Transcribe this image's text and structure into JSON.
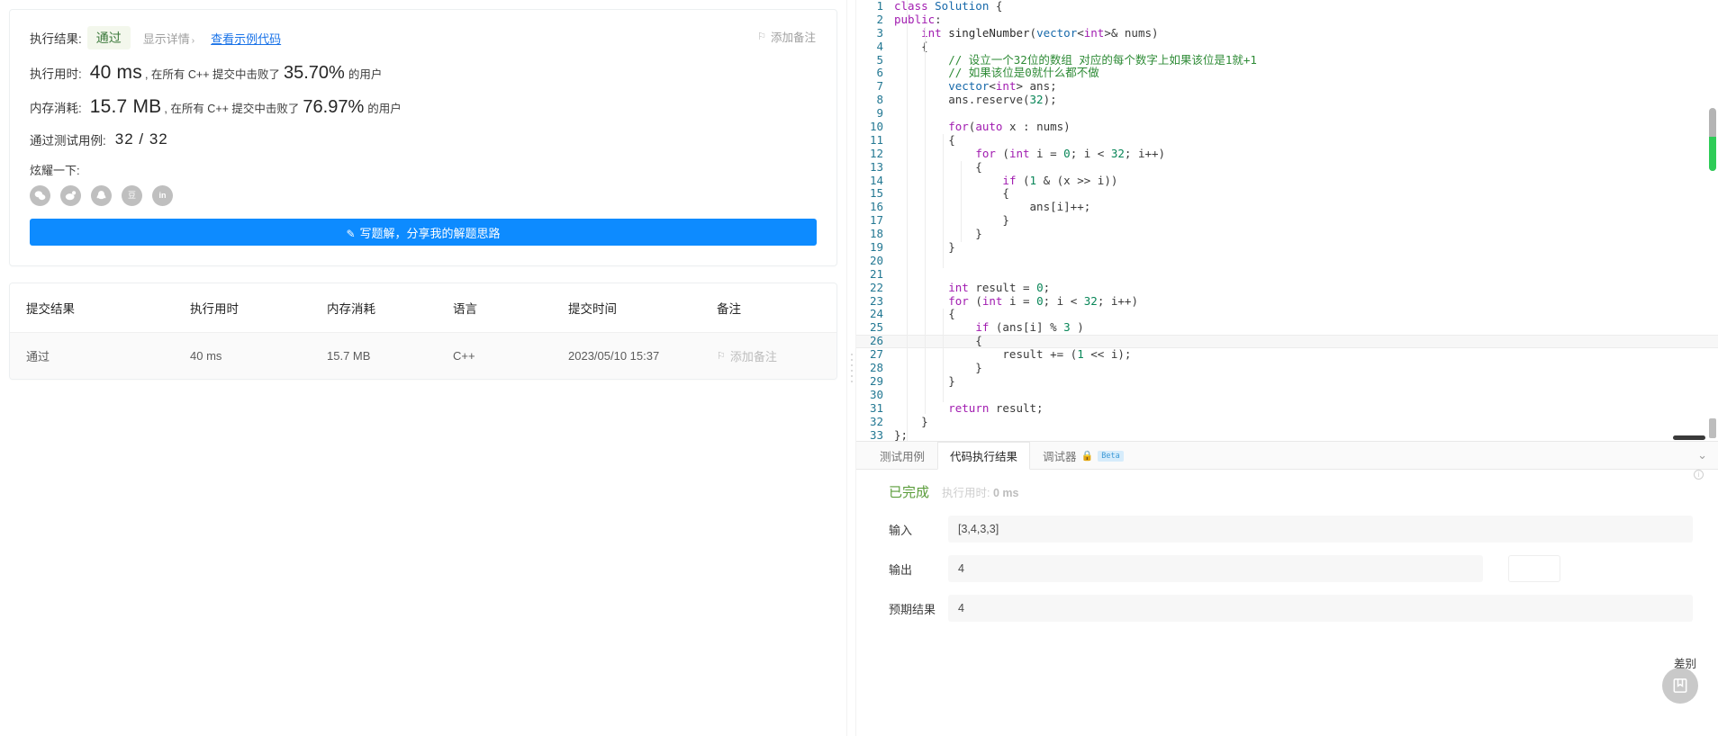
{
  "left": {
    "result_card": {
      "result_label": "执行结果:",
      "result_value": "通过",
      "show_detail": "显示详情",
      "show_detail_chevron": "›",
      "sample_code_link": "查看示例代码",
      "runtime_label": "执行用时:",
      "runtime_value": "40 ms",
      "runtime_mid": ", 在所有 C++ 提交中击败了",
      "runtime_pct": "35.70%",
      "runtime_tail": "的用户",
      "memory_label": "内存消耗:",
      "memory_value": "15.7 MB",
      "memory_mid": ", 在所有 C++ 提交中击败了",
      "memory_pct": "76.97%",
      "memory_tail": "的用户",
      "cases_label": "通过测试用例:",
      "cases_value": "32 / 32",
      "share_label": "炫耀一下:",
      "share_icons": [
        {
          "name": "wechat-share-icon",
          "glyph": "微"
        },
        {
          "name": "weibo-share-icon",
          "glyph": "微"
        },
        {
          "name": "qq-share-icon",
          "glyph": "Q"
        },
        {
          "name": "douban-share-icon",
          "glyph": "豆"
        },
        {
          "name": "linkedin-share-icon",
          "glyph": "in"
        }
      ],
      "write_solution_button": "写题解，分享我的解题思路",
      "add_note_top": "添加备注"
    },
    "submissions_table": {
      "headers": [
        "提交结果",
        "执行用时",
        "内存消耗",
        "语言",
        "提交时间",
        "备注"
      ],
      "rows": [
        {
          "result": "通过",
          "runtime": "40 ms",
          "memory": "15.7 MB",
          "language": "C++",
          "time": "2023/05/10 15:37",
          "note": "添加备注"
        }
      ]
    }
  },
  "editor": {
    "language": "cpp",
    "active_line": 26,
    "lines": [
      {
        "n": 1,
        "tokens": [
          {
            "t": "class ",
            "c": "kw"
          },
          {
            "t": "Solution ",
            "c": "typ"
          },
          {
            "t": "{",
            "c": "pun"
          }
        ]
      },
      {
        "n": 2,
        "tokens": [
          {
            "t": "public",
            "c": "kw"
          },
          {
            "t": ":",
            "c": "pun"
          }
        ]
      },
      {
        "n": 3,
        "tokens": [
          {
            "t": "    ",
            "c": "pun"
          },
          {
            "t": "int ",
            "c": "kw"
          },
          {
            "t": "singleNumber",
            "c": "fn"
          },
          {
            "t": "(",
            "c": "pun"
          },
          {
            "t": "vector",
            "c": "typ"
          },
          {
            "t": "<",
            "c": "pun"
          },
          {
            "t": "int",
            "c": "kw"
          },
          {
            "t": ">& nums)",
            "c": "pun"
          }
        ]
      },
      {
        "n": 4,
        "tokens": [
          {
            "t": "    {",
            "c": "pun"
          }
        ]
      },
      {
        "n": 5,
        "tokens": [
          {
            "t": "        // 设立一个32位的数组 对应的每个数字上如果该位是1就+1",
            "c": "cmt"
          }
        ]
      },
      {
        "n": 6,
        "tokens": [
          {
            "t": "        // 如果该位是0就什么都不做",
            "c": "cmt"
          }
        ]
      },
      {
        "n": 7,
        "tokens": [
          {
            "t": "        ",
            "c": "pun"
          },
          {
            "t": "vector",
            "c": "typ"
          },
          {
            "t": "<",
            "c": "pun"
          },
          {
            "t": "int",
            "c": "kw"
          },
          {
            "t": "> ans;",
            "c": "pun"
          }
        ]
      },
      {
        "n": 8,
        "tokens": [
          {
            "t": "        ans.reserve(",
            "c": "pun"
          },
          {
            "t": "32",
            "c": "num"
          },
          {
            "t": ");",
            "c": "pun"
          }
        ]
      },
      {
        "n": 9,
        "tokens": []
      },
      {
        "n": 10,
        "tokens": [
          {
            "t": "        ",
            "c": "pun"
          },
          {
            "t": "for",
            "c": "kw"
          },
          {
            "t": "(",
            "c": "pun"
          },
          {
            "t": "auto",
            "c": "kw"
          },
          {
            "t": " x : nums)",
            "c": "pun"
          }
        ]
      },
      {
        "n": 11,
        "tokens": [
          {
            "t": "        {",
            "c": "pun"
          }
        ]
      },
      {
        "n": 12,
        "tokens": [
          {
            "t": "            ",
            "c": "pun"
          },
          {
            "t": "for",
            "c": "kw"
          },
          {
            "t": " (",
            "c": "pun"
          },
          {
            "t": "int",
            "c": "kw"
          },
          {
            "t": " i = ",
            "c": "pun"
          },
          {
            "t": "0",
            "c": "num"
          },
          {
            "t": "; i < ",
            "c": "pun"
          },
          {
            "t": "32",
            "c": "num"
          },
          {
            "t": "; i++)",
            "c": "pun"
          }
        ]
      },
      {
        "n": 13,
        "tokens": [
          {
            "t": "            {",
            "c": "pun"
          }
        ]
      },
      {
        "n": 14,
        "tokens": [
          {
            "t": "                ",
            "c": "pun"
          },
          {
            "t": "if",
            "c": "kw"
          },
          {
            "t": " (",
            "c": "pun"
          },
          {
            "t": "1",
            "c": "num"
          },
          {
            "t": " & (x >> i))",
            "c": "pun"
          }
        ]
      },
      {
        "n": 15,
        "tokens": [
          {
            "t": "                {",
            "c": "pun"
          }
        ]
      },
      {
        "n": 16,
        "tokens": [
          {
            "t": "                    ans[i]++;",
            "c": "pun"
          }
        ]
      },
      {
        "n": 17,
        "tokens": [
          {
            "t": "                }",
            "c": "pun"
          }
        ]
      },
      {
        "n": 18,
        "tokens": [
          {
            "t": "            }",
            "c": "pun"
          }
        ]
      },
      {
        "n": 19,
        "tokens": [
          {
            "t": "        }",
            "c": "pun"
          }
        ]
      },
      {
        "n": 20,
        "tokens": []
      },
      {
        "n": 21,
        "tokens": []
      },
      {
        "n": 22,
        "tokens": [
          {
            "t": "        ",
            "c": "pun"
          },
          {
            "t": "int",
            "c": "kw"
          },
          {
            "t": " result = ",
            "c": "pun"
          },
          {
            "t": "0",
            "c": "num"
          },
          {
            "t": ";",
            "c": "pun"
          }
        ]
      },
      {
        "n": 23,
        "tokens": [
          {
            "t": "        ",
            "c": "pun"
          },
          {
            "t": "for",
            "c": "kw"
          },
          {
            "t": " (",
            "c": "pun"
          },
          {
            "t": "int",
            "c": "kw"
          },
          {
            "t": " i = ",
            "c": "pun"
          },
          {
            "t": "0",
            "c": "num"
          },
          {
            "t": "; i < ",
            "c": "pun"
          },
          {
            "t": "32",
            "c": "num"
          },
          {
            "t": "; i++)",
            "c": "pun"
          }
        ]
      },
      {
        "n": 24,
        "tokens": [
          {
            "t": "        {",
            "c": "pun"
          }
        ]
      },
      {
        "n": 25,
        "tokens": [
          {
            "t": "            ",
            "c": "pun"
          },
          {
            "t": "if",
            "c": "kw"
          },
          {
            "t": " (ans[i] % ",
            "c": "pun"
          },
          {
            "t": "3",
            "c": "num"
          },
          {
            "t": " )",
            "c": "pun"
          }
        ]
      },
      {
        "n": 26,
        "tokens": [
          {
            "t": "            {",
            "c": "pun"
          }
        ]
      },
      {
        "n": 27,
        "tokens": [
          {
            "t": "                result += (",
            "c": "pun"
          },
          {
            "t": "1",
            "c": "num"
          },
          {
            "t": " << i);",
            "c": "pun"
          }
        ]
      },
      {
        "n": 28,
        "tokens": [
          {
            "t": "            }",
            "c": "pun"
          }
        ]
      },
      {
        "n": 29,
        "tokens": [
          {
            "t": "        }",
            "c": "pun"
          }
        ]
      },
      {
        "n": 30,
        "tokens": []
      },
      {
        "n": 31,
        "tokens": [
          {
            "t": "        ",
            "c": "pun"
          },
          {
            "t": "return",
            "c": "kw"
          },
          {
            "t": " result;",
            "c": "pun"
          }
        ]
      },
      {
        "n": 32,
        "tokens": [
          {
            "t": "    }",
            "c": "pun"
          }
        ]
      },
      {
        "n": 33,
        "tokens": [
          {
            "t": "};",
            "c": "pun"
          }
        ]
      }
    ]
  },
  "console": {
    "tabs": [
      {
        "label": "测试用例",
        "active": false,
        "lock": false,
        "beta": null
      },
      {
        "label": "代码执行结果",
        "active": true,
        "lock": false,
        "beta": null
      },
      {
        "label": "调试器",
        "active": false,
        "lock": true,
        "beta": "Beta"
      }
    ],
    "collapse_icon": "⌄",
    "status": "已完成",
    "runtime_label": "执行用时:",
    "runtime_value": "0 ms",
    "fields": [
      {
        "label": "输入",
        "value": "[3,4,3,3]"
      },
      {
        "label": "输出",
        "value": "4"
      },
      {
        "label": "预期结果",
        "value": "4"
      }
    ],
    "fab_label": "差别"
  },
  "colors": {
    "accent_blue": "#0d8bff",
    "pass_green": "#5a9c3a",
    "link_blue": "#1a73e8",
    "scroll_green": "#2ecc57"
  }
}
